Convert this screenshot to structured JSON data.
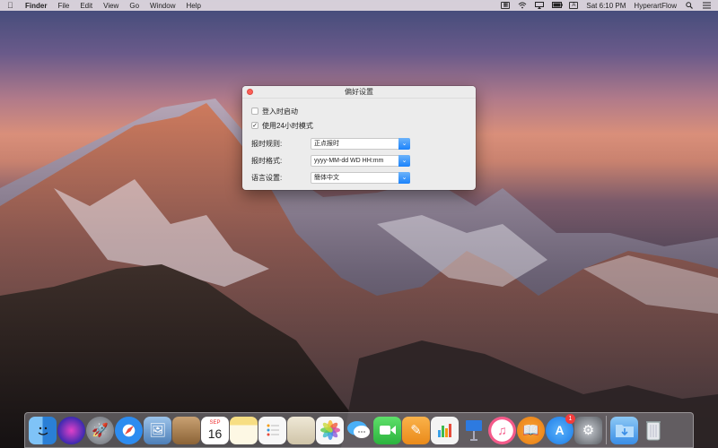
{
  "menubar": {
    "app_name": "Finder",
    "items": [
      "File",
      "Edit",
      "View",
      "Go",
      "Window",
      "Help"
    ],
    "clock": "Sat 6:10 PM",
    "user": "HyperartFlow"
  },
  "window": {
    "title": "偏好设置",
    "launch_at_login_label": "登入时启动",
    "launch_at_login_checked": false,
    "use_24h_label": "使用24小时模式",
    "use_24h_checked": true,
    "announce_rule_label": "报时规则:",
    "announce_rule_value": "正点报时",
    "announce_format_label": "报时格式:",
    "announce_format_value": "yyyy-MM-dd WD HH:mm",
    "language_label": "语言设置:",
    "language_value": "簡体中文"
  },
  "dock": {
    "calendar_month": "SEP",
    "calendar_day": "16",
    "app_store_badge": "1",
    "apps": [
      {
        "name": "finder-icon",
        "color": "#3a8ee6"
      },
      {
        "name": "siri-icon",
        "color": "#5b3fc4"
      },
      {
        "name": "launchpad-icon",
        "color": "#8d9299"
      },
      {
        "name": "safari-icon",
        "color": "#2d8cf0"
      },
      {
        "name": "preview-icon",
        "color": "#6a9fd8"
      },
      {
        "name": "contacts-icon",
        "color": "#b38a5a"
      },
      {
        "name": "calendar-icon",
        "color": "#ffffff"
      },
      {
        "name": "notes-icon",
        "color": "#f5d36b"
      },
      {
        "name": "reminders-icon",
        "color": "#f4f4f4"
      },
      {
        "name": "photo-slideshow-icon",
        "color": "#e9e4d6"
      },
      {
        "name": "photos-icon",
        "color": "#f4f4f4"
      },
      {
        "name": "messages-icon",
        "color": "#3fa6f5"
      },
      {
        "name": "facetime-icon",
        "color": "#39c34f"
      },
      {
        "name": "pages-icon",
        "color": "#f2a23a"
      },
      {
        "name": "numbers-icon",
        "color": "#3dba4e"
      },
      {
        "name": "keynote-icon",
        "color": "#3571c8"
      },
      {
        "name": "itunes-icon",
        "color": "#f45a8a"
      },
      {
        "name": "ibooks-icon",
        "color": "#f39220"
      },
      {
        "name": "app-store-icon",
        "color": "#2d90f3"
      },
      {
        "name": "system-preferences-icon",
        "color": "#8b8f94"
      }
    ]
  },
  "colors": {
    "accent": "#1a82fb",
    "close": "#fc5f57"
  }
}
